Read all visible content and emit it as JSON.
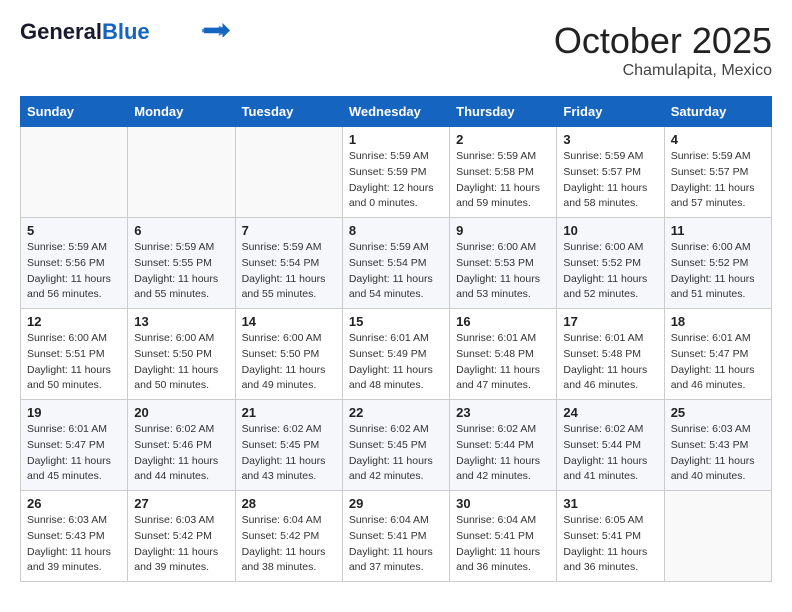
{
  "header": {
    "logo_general": "General",
    "logo_blue": "Blue",
    "month": "October 2025",
    "location": "Chamulapita, Mexico"
  },
  "weekdays": [
    "Sunday",
    "Monday",
    "Tuesday",
    "Wednesday",
    "Thursday",
    "Friday",
    "Saturday"
  ],
  "weeks": [
    [
      {
        "day": "",
        "info": ""
      },
      {
        "day": "",
        "info": ""
      },
      {
        "day": "",
        "info": ""
      },
      {
        "day": "1",
        "info": "Sunrise: 5:59 AM\nSunset: 5:59 PM\nDaylight: 12 hours\nand 0 minutes."
      },
      {
        "day": "2",
        "info": "Sunrise: 5:59 AM\nSunset: 5:58 PM\nDaylight: 11 hours\nand 59 minutes."
      },
      {
        "day": "3",
        "info": "Sunrise: 5:59 AM\nSunset: 5:57 PM\nDaylight: 11 hours\nand 58 minutes."
      },
      {
        "day": "4",
        "info": "Sunrise: 5:59 AM\nSunset: 5:57 PM\nDaylight: 11 hours\nand 57 minutes."
      }
    ],
    [
      {
        "day": "5",
        "info": "Sunrise: 5:59 AM\nSunset: 5:56 PM\nDaylight: 11 hours\nand 56 minutes."
      },
      {
        "day": "6",
        "info": "Sunrise: 5:59 AM\nSunset: 5:55 PM\nDaylight: 11 hours\nand 55 minutes."
      },
      {
        "day": "7",
        "info": "Sunrise: 5:59 AM\nSunset: 5:54 PM\nDaylight: 11 hours\nand 55 minutes."
      },
      {
        "day": "8",
        "info": "Sunrise: 5:59 AM\nSunset: 5:54 PM\nDaylight: 11 hours\nand 54 minutes."
      },
      {
        "day": "9",
        "info": "Sunrise: 6:00 AM\nSunset: 5:53 PM\nDaylight: 11 hours\nand 53 minutes."
      },
      {
        "day": "10",
        "info": "Sunrise: 6:00 AM\nSunset: 5:52 PM\nDaylight: 11 hours\nand 52 minutes."
      },
      {
        "day": "11",
        "info": "Sunrise: 6:00 AM\nSunset: 5:52 PM\nDaylight: 11 hours\nand 51 minutes."
      }
    ],
    [
      {
        "day": "12",
        "info": "Sunrise: 6:00 AM\nSunset: 5:51 PM\nDaylight: 11 hours\nand 50 minutes."
      },
      {
        "day": "13",
        "info": "Sunrise: 6:00 AM\nSunset: 5:50 PM\nDaylight: 11 hours\nand 50 minutes."
      },
      {
        "day": "14",
        "info": "Sunrise: 6:00 AM\nSunset: 5:50 PM\nDaylight: 11 hours\nand 49 minutes."
      },
      {
        "day": "15",
        "info": "Sunrise: 6:01 AM\nSunset: 5:49 PM\nDaylight: 11 hours\nand 48 minutes."
      },
      {
        "day": "16",
        "info": "Sunrise: 6:01 AM\nSunset: 5:48 PM\nDaylight: 11 hours\nand 47 minutes."
      },
      {
        "day": "17",
        "info": "Sunrise: 6:01 AM\nSunset: 5:48 PM\nDaylight: 11 hours\nand 46 minutes."
      },
      {
        "day": "18",
        "info": "Sunrise: 6:01 AM\nSunset: 5:47 PM\nDaylight: 11 hours\nand 46 minutes."
      }
    ],
    [
      {
        "day": "19",
        "info": "Sunrise: 6:01 AM\nSunset: 5:47 PM\nDaylight: 11 hours\nand 45 minutes."
      },
      {
        "day": "20",
        "info": "Sunrise: 6:02 AM\nSunset: 5:46 PM\nDaylight: 11 hours\nand 44 minutes."
      },
      {
        "day": "21",
        "info": "Sunrise: 6:02 AM\nSunset: 5:45 PM\nDaylight: 11 hours\nand 43 minutes."
      },
      {
        "day": "22",
        "info": "Sunrise: 6:02 AM\nSunset: 5:45 PM\nDaylight: 11 hours\nand 42 minutes."
      },
      {
        "day": "23",
        "info": "Sunrise: 6:02 AM\nSunset: 5:44 PM\nDaylight: 11 hours\nand 42 minutes."
      },
      {
        "day": "24",
        "info": "Sunrise: 6:02 AM\nSunset: 5:44 PM\nDaylight: 11 hours\nand 41 minutes."
      },
      {
        "day": "25",
        "info": "Sunrise: 6:03 AM\nSunset: 5:43 PM\nDaylight: 11 hours\nand 40 minutes."
      }
    ],
    [
      {
        "day": "26",
        "info": "Sunrise: 6:03 AM\nSunset: 5:43 PM\nDaylight: 11 hours\nand 39 minutes."
      },
      {
        "day": "27",
        "info": "Sunrise: 6:03 AM\nSunset: 5:42 PM\nDaylight: 11 hours\nand 39 minutes."
      },
      {
        "day": "28",
        "info": "Sunrise: 6:04 AM\nSunset: 5:42 PM\nDaylight: 11 hours\nand 38 minutes."
      },
      {
        "day": "29",
        "info": "Sunrise: 6:04 AM\nSunset: 5:41 PM\nDaylight: 11 hours\nand 37 minutes."
      },
      {
        "day": "30",
        "info": "Sunrise: 6:04 AM\nSunset: 5:41 PM\nDaylight: 11 hours\nand 36 minutes."
      },
      {
        "day": "31",
        "info": "Sunrise: 6:05 AM\nSunset: 5:41 PM\nDaylight: 11 hours\nand 36 minutes."
      },
      {
        "day": "",
        "info": ""
      }
    ]
  ]
}
